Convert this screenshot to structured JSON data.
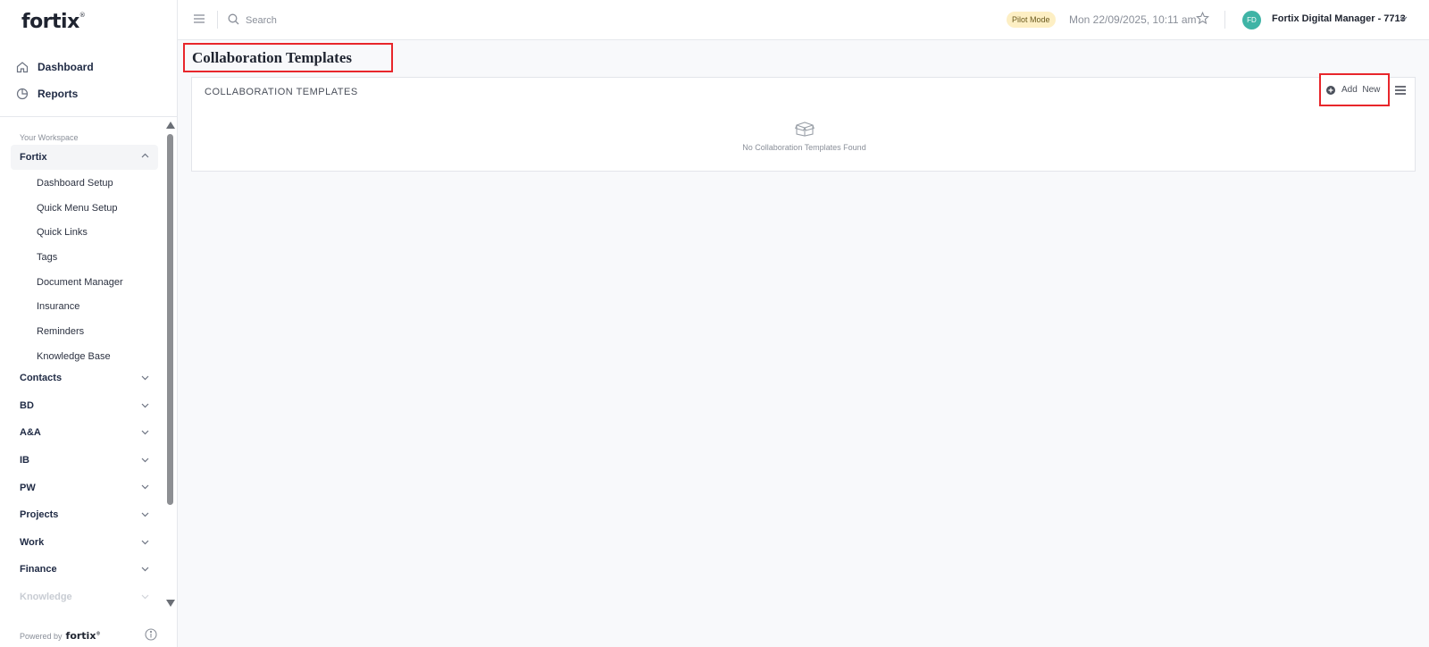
{
  "brand": {
    "logo_text": "fortix",
    "logo_mark": "®"
  },
  "top_nav": [
    {
      "label": "Dashboard",
      "icon": "home-icon"
    },
    {
      "label": "Reports",
      "icon": "pie-chart-icon"
    }
  ],
  "workspace": {
    "label": "Your Workspace",
    "open_group": {
      "label": "Fortix",
      "items": [
        "Dashboard Setup",
        "Quick Menu Setup",
        "Quick Links",
        "Tags",
        "Document Manager",
        "Insurance",
        "Reminders",
        "Knowledge Base"
      ]
    },
    "groups": [
      "Contacts",
      "BD",
      "A&A",
      "IB",
      "PW",
      "Projects",
      "Work",
      "Finance",
      "Knowledge"
    ]
  },
  "footer": {
    "powered_label": "Powered by",
    "powered_brand": "fortix"
  },
  "header": {
    "search_placeholder": "Search",
    "mode_badge": "Pilot Mode",
    "datetime": "Mon 22/09/2025, 10:11 am",
    "avatar_initials": "FD",
    "user_name": "Fortix Digital Manager - 7713"
  },
  "main": {
    "page_title": "Collaboration Templates",
    "panel_title": "COLLABORATION  TEMPLATES",
    "add_new_label": "Add  New",
    "empty_message": "No Collaboration Templates Found"
  },
  "colors": {
    "accent_highlight": "#e8262b",
    "avatar_bg": "#3fb4a6",
    "badge_bg": "#fdefc4"
  }
}
